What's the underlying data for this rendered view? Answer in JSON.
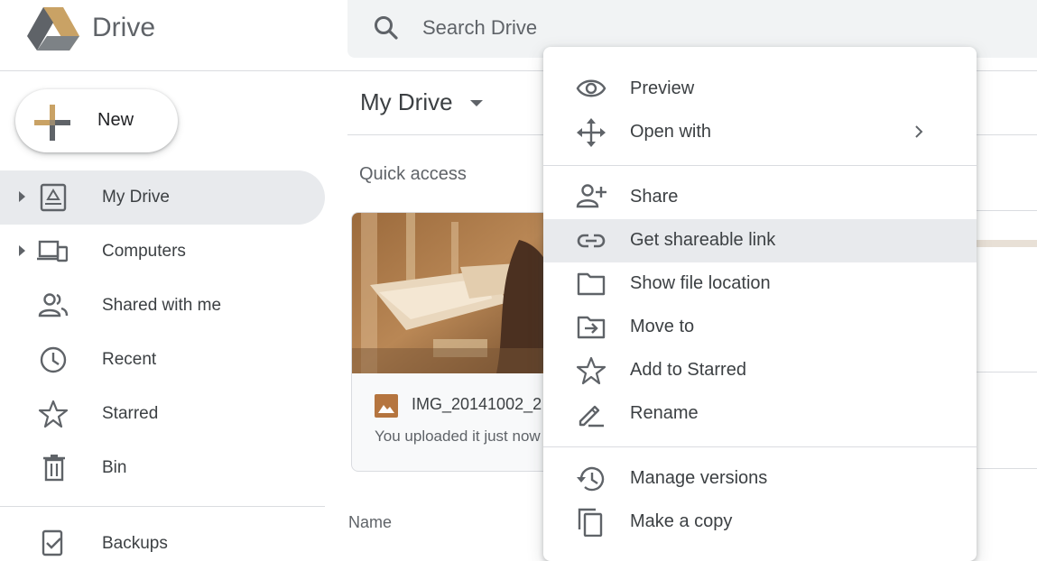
{
  "app": {
    "title": "Drive"
  },
  "search": {
    "placeholder": "Search Drive"
  },
  "sidebar": {
    "new_label": "New",
    "items": [
      {
        "label": "My Drive",
        "icon": "my-drive-icon",
        "active": true
      },
      {
        "label": "Computers",
        "icon": "computers-icon"
      },
      {
        "label": "Shared with me",
        "icon": "shared-icon"
      },
      {
        "label": "Recent",
        "icon": "clock-icon"
      },
      {
        "label": "Starred",
        "icon": "star-icon"
      },
      {
        "label": "Bin",
        "icon": "trash-icon"
      },
      {
        "label": "Backups",
        "icon": "backups-icon"
      }
    ]
  },
  "main": {
    "title": "My Drive",
    "quick_access_label": "Quick access",
    "card": {
      "file_name": "IMG_20141002_2",
      "subtitle": "You uploaded it just now"
    },
    "name_column": "Name"
  },
  "context_menu": {
    "items": [
      {
        "label": "Preview",
        "icon": "eye-icon"
      },
      {
        "label": "Open with",
        "icon": "move-arrows-icon",
        "submenu": true
      },
      {
        "label": "Share",
        "icon": "person-add-icon"
      },
      {
        "label": "Get shareable link",
        "icon": "link-icon",
        "hovered": true
      },
      {
        "label": "Show file location",
        "icon": "folder-icon"
      },
      {
        "label": "Move to",
        "icon": "move-to-folder-icon"
      },
      {
        "label": "Add to Starred",
        "icon": "star-icon"
      },
      {
        "label": "Rename",
        "icon": "pencil-icon"
      },
      {
        "label": "Manage versions",
        "icon": "history-icon"
      },
      {
        "label": "Make a copy",
        "icon": "copy-icon"
      }
    ]
  },
  "colors": {
    "drive_gray": "#5f6368",
    "drive_gold": "#c8a165",
    "active_bg": "#e8eaed",
    "divider": "#dadce0"
  }
}
